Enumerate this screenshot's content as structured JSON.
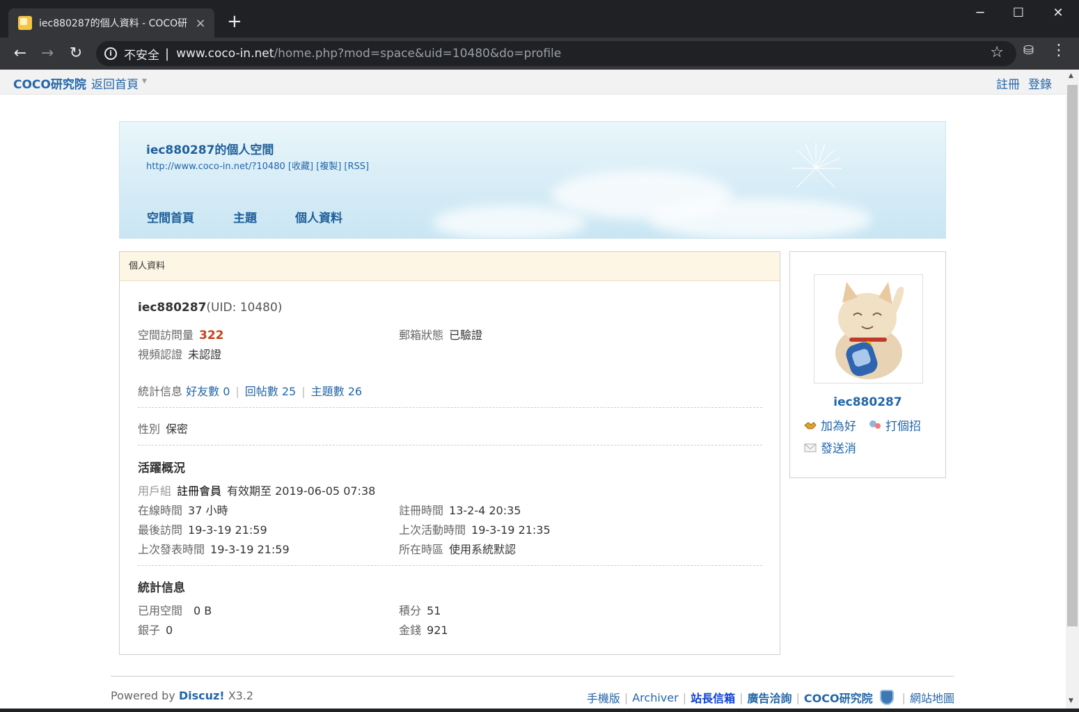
{
  "browser": {
    "tab_title": "iec880287的個人資料 - COCO研",
    "tab_close": "×",
    "new_tab": "+",
    "minimize": "─",
    "maximize": "☐",
    "close": "✕",
    "back": "←",
    "forward": "→",
    "reload": "↻",
    "insecure_label": "不安全",
    "url_host": "www.coco-in.net",
    "url_path": "/home.php?mod=space&uid=10480&do=profile",
    "star": "☆",
    "extension": "⛁",
    "menu": "⋮"
  },
  "topnav": {
    "site_name": "COCO研究院",
    "home_link": "返回首頁",
    "register": "註冊",
    "login": "登錄"
  },
  "banner": {
    "title": "iec880287的個人空間",
    "url_line": "http://www.coco-in.net/?10480 [收藏] [複製] [RSS]",
    "nav": [
      "空間首頁",
      "主題",
      "個人資料"
    ]
  },
  "profile": {
    "header": "個人資料",
    "username": "iec880287",
    "uid": "(UID: 10480)",
    "visits_label": "空間訪問量",
    "visits_value": "322",
    "email_label": "郵箱狀態",
    "email_value": "已驗證",
    "video_label": "視頻認證",
    "video_value": "未認證",
    "stats_label": "統計信息",
    "friends": "好友數 0",
    "replies": "回帖數 25",
    "threads": "主題數 26",
    "gender_label": "性別",
    "gender_value": "保密",
    "activity_title": "活躍概況",
    "group_label": "用戶組",
    "group_value": "註冊會員",
    "group_expire": "有效期至 2019-06-05 07:38",
    "online_label": "在線時間",
    "online_value": "37 小時",
    "reg_label": "註冊時間",
    "reg_value": "13-2-4 20:35",
    "last_visit_label": "最後訪問",
    "last_visit_value": "19-3-19 21:59",
    "last_active_label": "上次活動時間",
    "last_active_value": "19-3-19 21:35",
    "last_post_label": "上次發表時間",
    "last_post_value": "19-3-19 21:59",
    "timezone_label": "所在時區",
    "timezone_value": "使用系統默認",
    "stats_title": "統計信息",
    "space_label": "已用空間",
    "space_value": "0 B",
    "credits_label": "積分",
    "credits_value": "51",
    "silver_label": "銀子",
    "silver_value": "0",
    "gold_label": "金錢",
    "gold_value": "921"
  },
  "sidebar": {
    "name": "iec880287",
    "add_friend": "加為好",
    "poke": "打個招",
    "send_msg": "發送消"
  },
  "footer": {
    "powered_prefix": "Powered by ",
    "powered_brand": "Discuz!",
    "powered_version": " X3.2",
    "links": [
      "手機版",
      "Archiver",
      "站長信箱",
      "廣告洽詢",
      "COCO研究院",
      "網站地圖"
    ]
  }
}
